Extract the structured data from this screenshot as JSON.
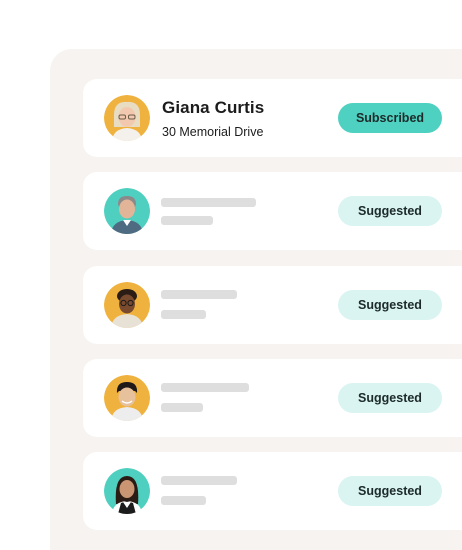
{
  "contacts": [
    {
      "name": "Giana Curtis",
      "address": "30 Memorial Drive",
      "status": "Subscribed",
      "avatar_bg": "#f0b23e",
      "status_color": "#4fd1c1"
    },
    {
      "status": "Suggested",
      "avatar_bg": "#4fcfbf",
      "status_color": "#daf4f1"
    },
    {
      "status": "Suggested",
      "avatar_bg": "#f0b23e",
      "status_color": "#daf4f1"
    },
    {
      "status": "Suggested",
      "avatar_bg": "#f0b23e",
      "status_color": "#daf4f1"
    },
    {
      "status": "Suggested",
      "avatar_bg": "#4fcfbf",
      "status_color": "#daf4f1"
    }
  ],
  "colors": {
    "panel_bg": "#f6f3f0",
    "card_bg": "#ffffff",
    "skeleton": "#dedede"
  }
}
